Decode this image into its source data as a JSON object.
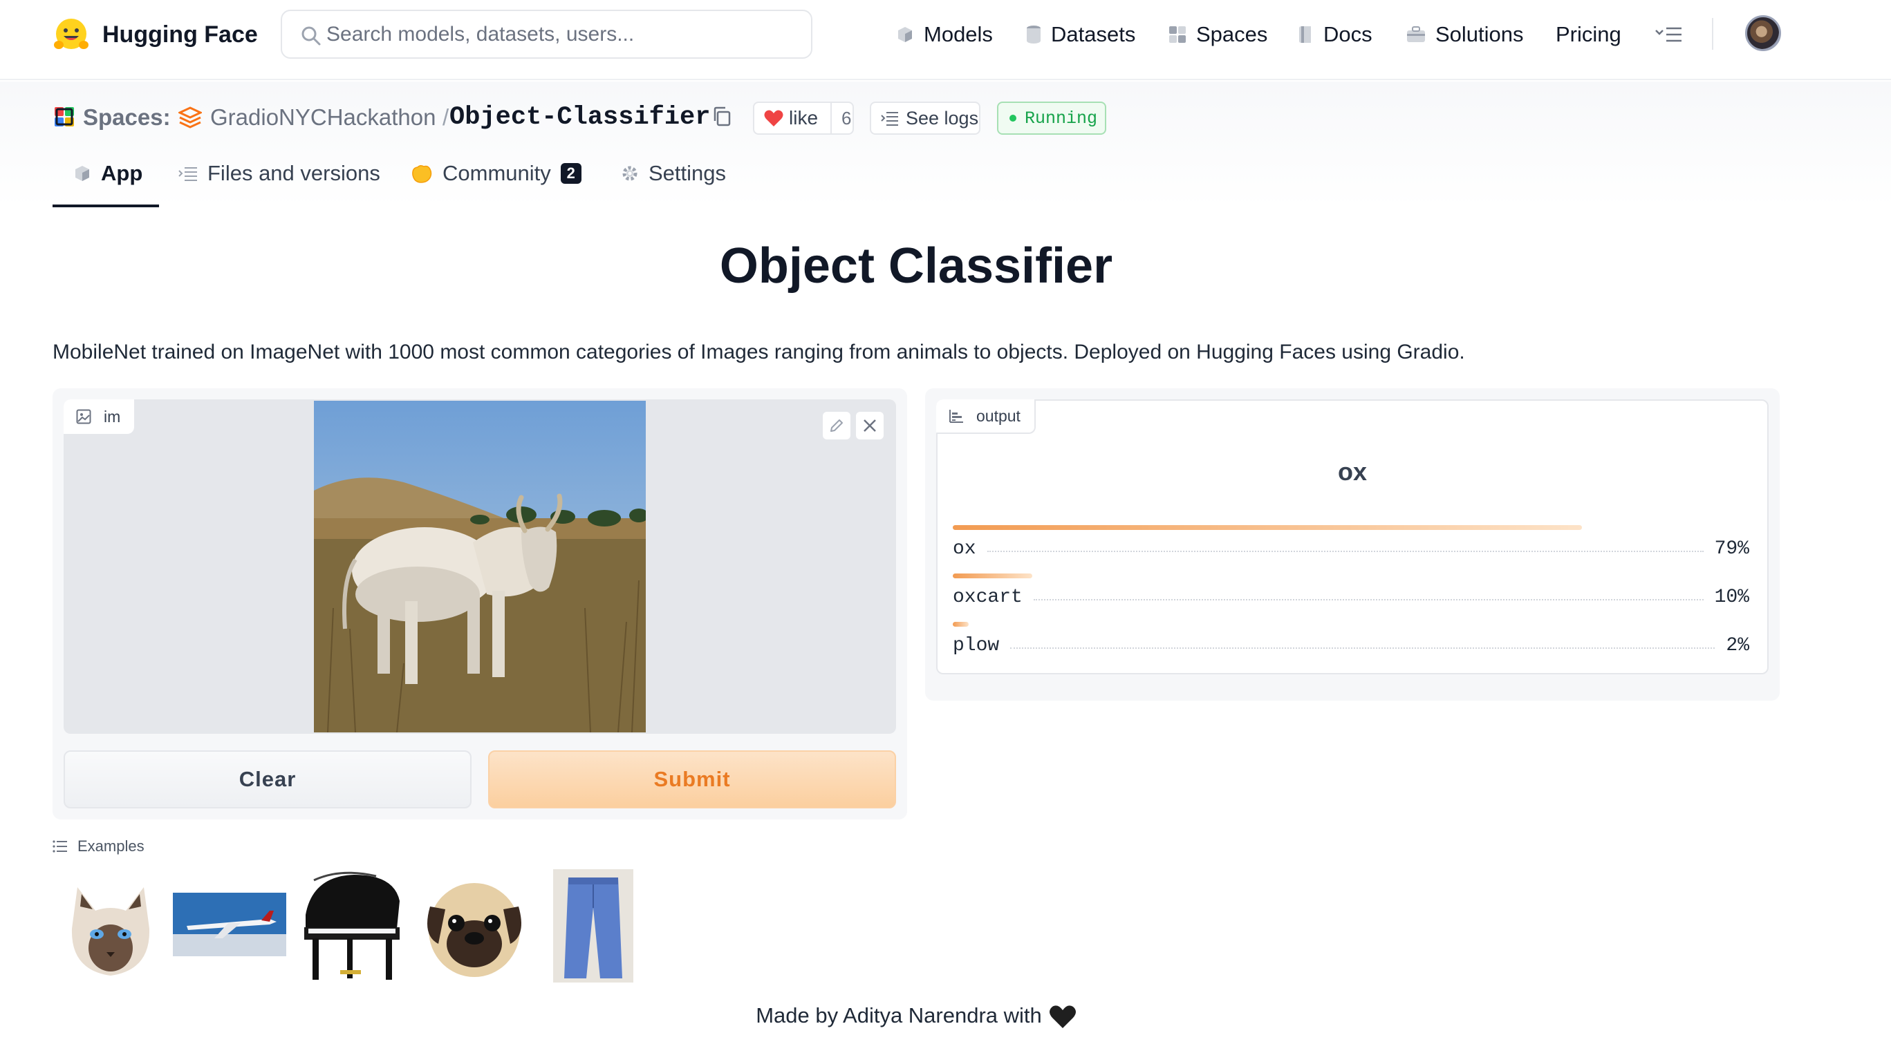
{
  "nav": {
    "brand": "Hugging Face",
    "search_placeholder": "Search models, datasets, users...",
    "items": [
      "Models",
      "Datasets",
      "Spaces",
      "Docs",
      "Solutions",
      "Pricing"
    ]
  },
  "space": {
    "section_label": "Spaces:",
    "org": "GradioNYCHackathon",
    "separator": "/",
    "name": "Object-Classifier",
    "like_label": "like",
    "like_count": "6",
    "see_logs": "See logs",
    "status": "Running",
    "status_color": "#16a34a"
  },
  "tabs": {
    "app": "App",
    "files": "Files and versions",
    "community": "Community",
    "community_count": "2",
    "settings": "Settings"
  },
  "app": {
    "title": "Object Classifier",
    "description": "MobileNet trained on ImageNet with 1000 most common categories of Images ranging from animals to objects. Deployed on Hugging Faces using Gradio.",
    "input_label": "im",
    "output_label": "output",
    "clear_label": "Clear",
    "submit_label": "Submit",
    "accent_color": "#ea7b23",
    "prediction": {
      "label": "ox",
      "confidences": [
        {
          "label": "ox",
          "value": 0.79,
          "display": "79%"
        },
        {
          "label": "oxcart",
          "value": 0.1,
          "display": "10%"
        },
        {
          "label": "plow",
          "value": 0.02,
          "display": "2%"
        }
      ]
    },
    "examples_label": "Examples",
    "examples": [
      "cat",
      "airplane",
      "piano",
      "pug",
      "jeans"
    ]
  },
  "footer": {
    "text": "Made by Aditya Narendra with"
  }
}
